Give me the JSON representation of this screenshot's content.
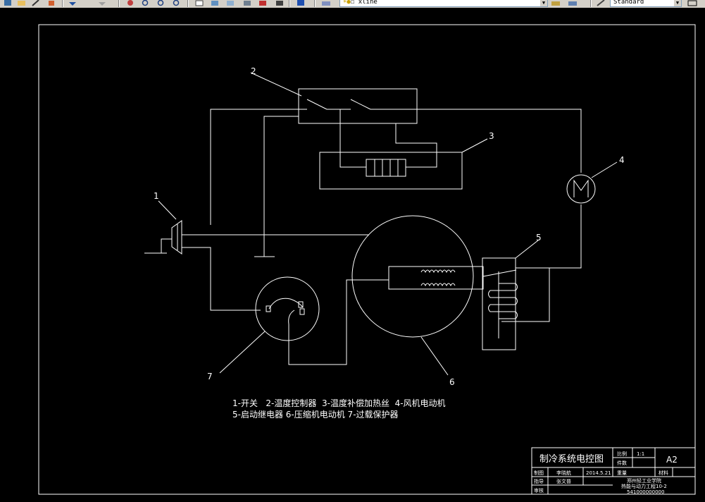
{
  "toolbar": {
    "layer_combo_value": "xline",
    "style_combo_value": "Standard"
  },
  "drawing": {
    "labels": [
      "1",
      "2",
      "3",
      "4",
      "5",
      "6",
      "7"
    ],
    "legend_line1": "1-开关   2-温度控制器  3-温度补偿加热丝  4-风机电动机",
    "legend_line2": "5-启动继电器  6-压缩机电动机  7-过载保护器"
  },
  "title_block": {
    "title": "制冷系统电控图",
    "scale_label": "比例",
    "scale_value": "1:1",
    "count_label": "件数",
    "sheet_size": "A2",
    "drawn_label": "制图",
    "drawn_name": "李晓航",
    "drawn_date": "2014.5.21",
    "weight_label": "重量",
    "material_label": "材料",
    "guide_label": "指导",
    "guide_name": "张文普",
    "review_label": "审核",
    "school": "郑州轻工业学院",
    "class": "热能与动力工程10-2",
    "student_no": "541000000000"
  }
}
